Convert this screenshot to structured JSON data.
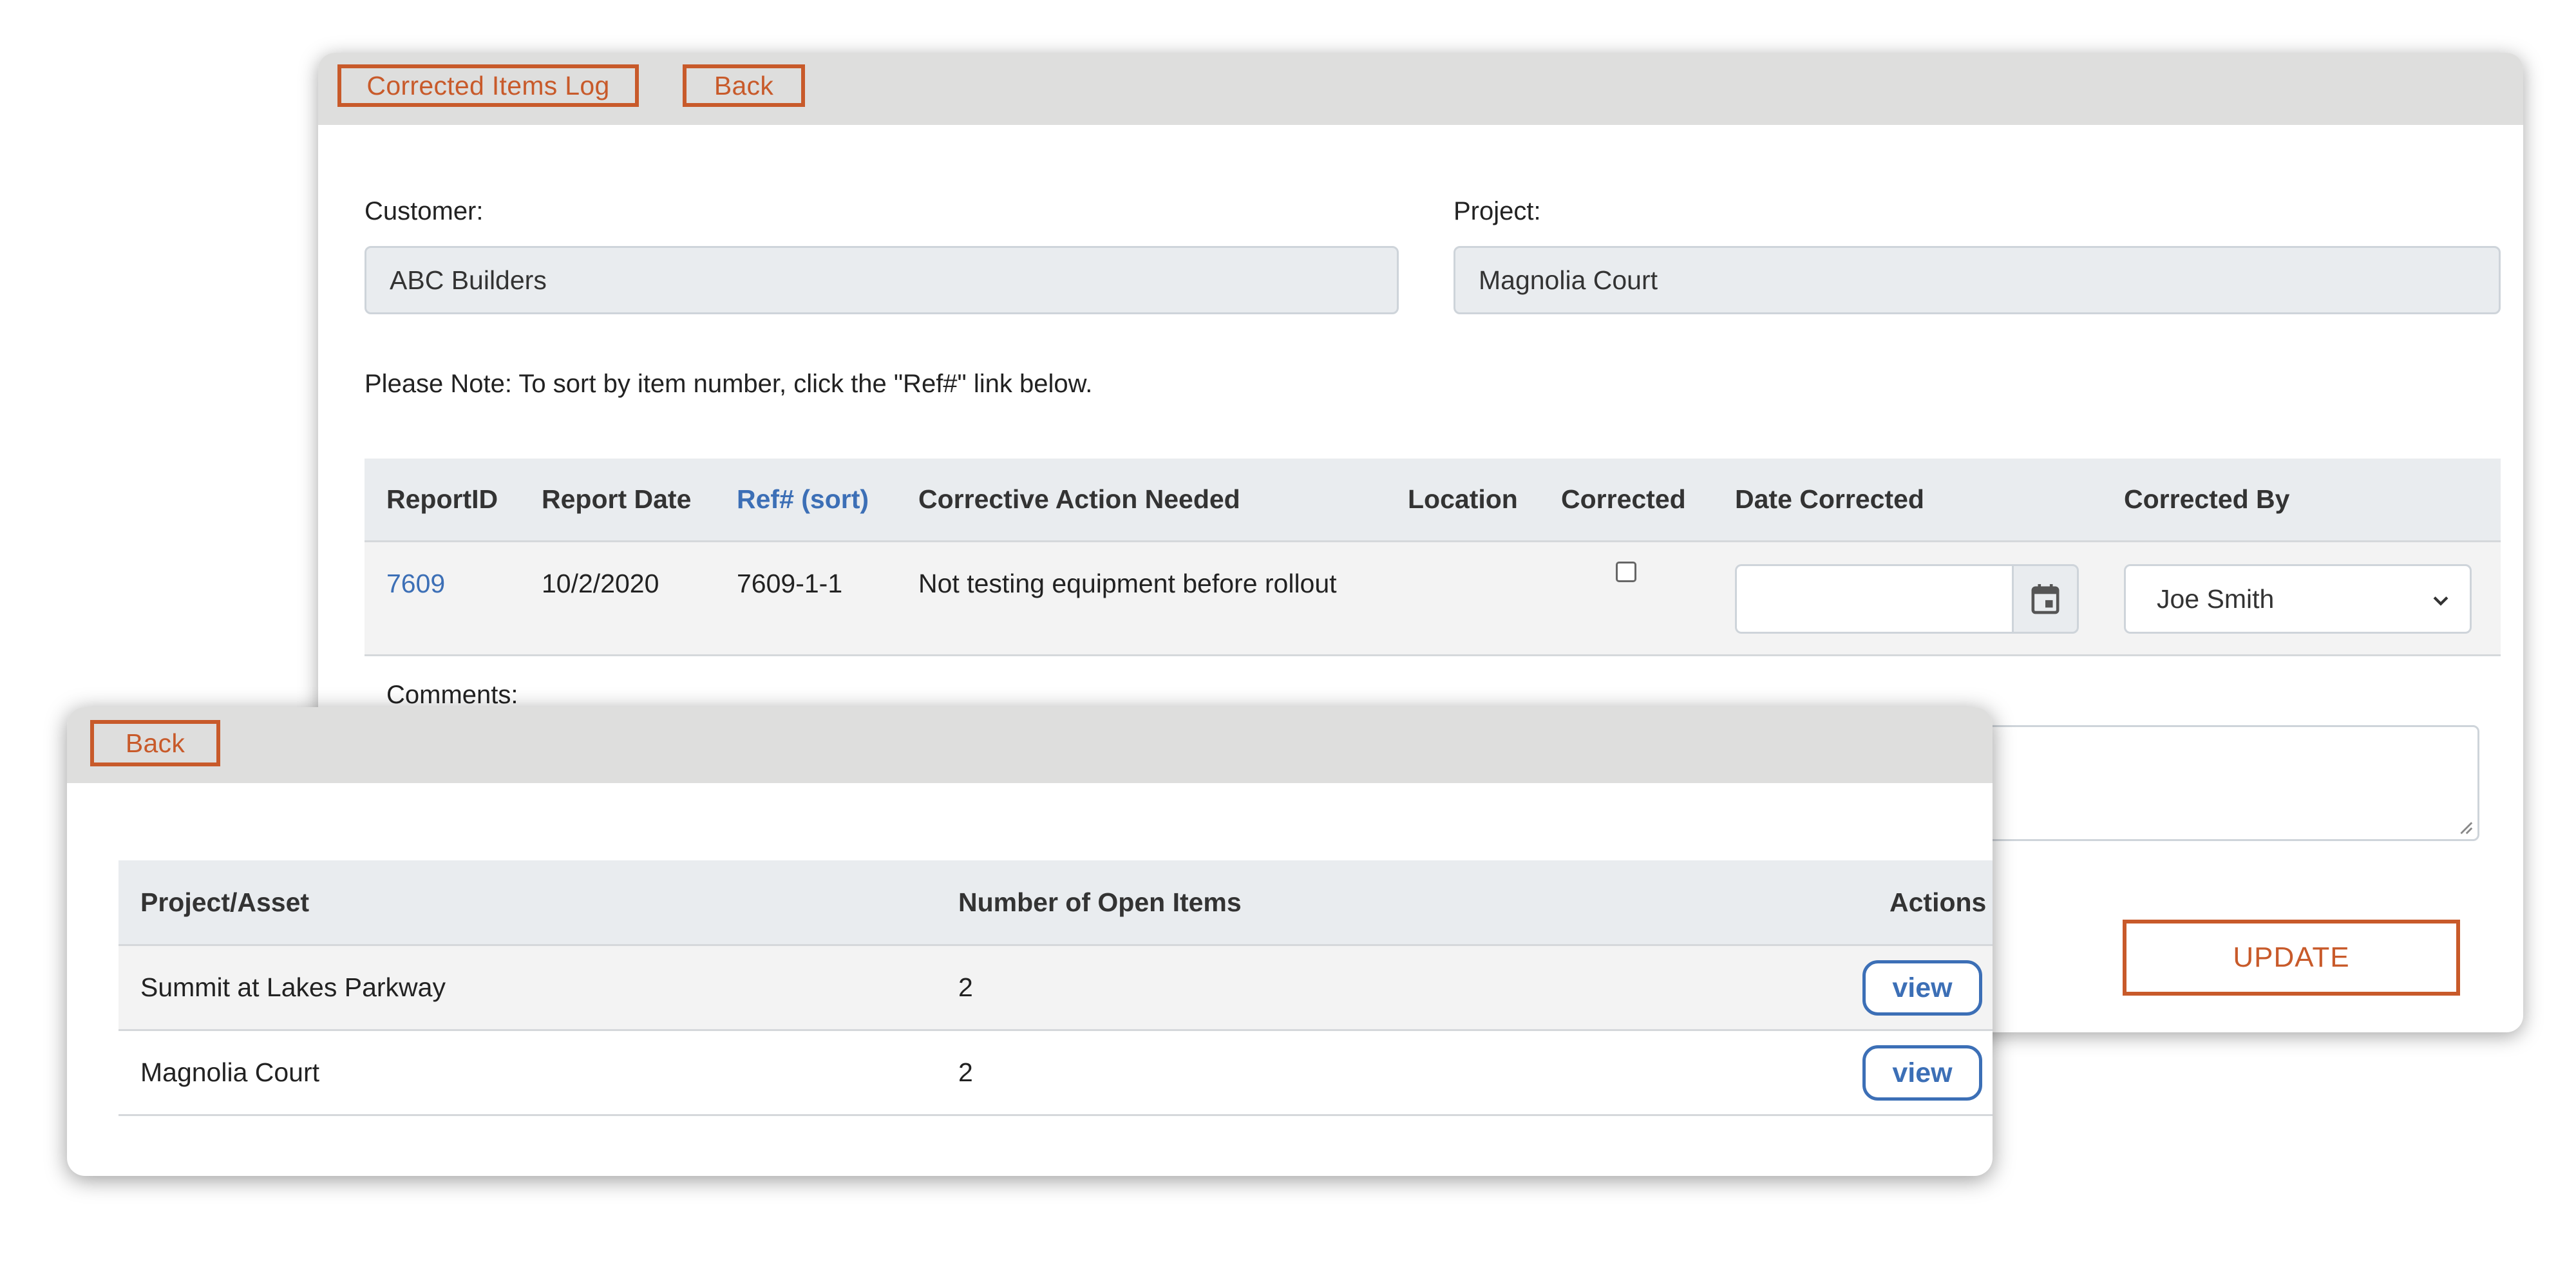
{
  "edit_form": {
    "toolbar": {
      "corrected_items_log_label": "Corrected Items Log",
      "back_label": "Back"
    },
    "customer": {
      "label": "Customer:",
      "value": "ABC Builders"
    },
    "project": {
      "label": "Project:",
      "value": "Magnolia Court"
    },
    "note": "Please Note: To sort by item number, click the \"Ref#\" link below.",
    "table": {
      "headers": {
        "report_id": "ReportID",
        "report_date": "Report Date",
        "ref": "Ref# (sort)",
        "corrective_action": "Corrective Action Needed",
        "location": "Location",
        "corrected": "Corrected",
        "date_corrected": "Date Corrected",
        "corrected_by": "Corrected By"
      },
      "row": {
        "report_id": "7609",
        "report_date": "10/2/2020",
        "ref": "7609-1-1",
        "corrective_action": "Not testing equipment before rollout",
        "location": "",
        "corrected": false,
        "date_corrected": "",
        "corrected_by": "Joe Smith"
      }
    },
    "comments_label": "Comments:",
    "update_label": "UPDATE"
  },
  "project_list": {
    "back_label": "Back",
    "headers": {
      "project": "Project/Asset",
      "open_items": "Number of Open Items",
      "actions": "Actions"
    },
    "rows": [
      {
        "project": "Summit at Lakes Parkway",
        "open_items": "2",
        "action_label": "view"
      },
      {
        "project": "Magnolia Court",
        "open_items": "2",
        "action_label": "view"
      }
    ]
  },
  "colors": {
    "accent_orange": "#c85a2a",
    "link_blue": "#3c6fb6",
    "toolbar_gray": "#dededd",
    "header_gray": "#e9ecef"
  },
  "icons": {
    "calendar": "calendar-icon",
    "dropdown": "chevron-down-icon",
    "resize": "resize-handle-icon"
  }
}
